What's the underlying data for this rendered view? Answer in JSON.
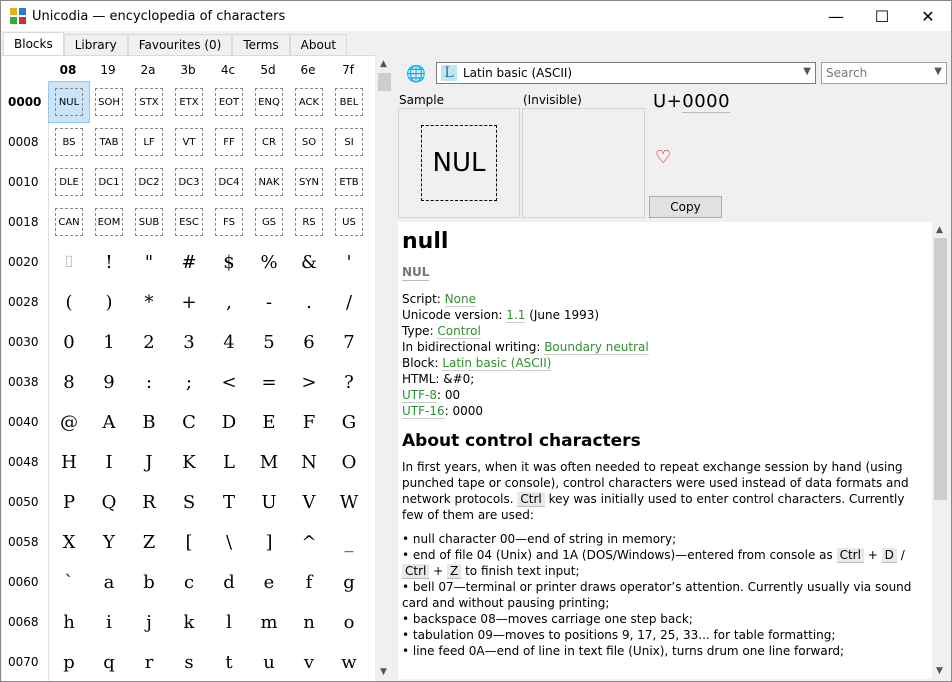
{
  "window": {
    "title": "Unicodia — encyclopedia of characters",
    "minimize": "—",
    "maximize": "☐",
    "close": "✕"
  },
  "tabs": [
    {
      "label": "Blocks",
      "active": true
    },
    {
      "label": "Library"
    },
    {
      "label": "Favourites (0)"
    },
    {
      "label": "Terms"
    },
    {
      "label": "About"
    }
  ],
  "table": {
    "columns": [
      "08",
      "19",
      "2a",
      "3b",
      "4c",
      "5d",
      "6e",
      "7f"
    ],
    "rows": [
      "0000",
      "0008",
      "0010",
      "0018",
      "0020",
      "0028",
      "0030",
      "0038",
      "0040",
      "0048",
      "0050",
      "0058",
      "0060",
      "0068",
      "0070"
    ],
    "cells": [
      [
        "NUL",
        "SOH",
        "STX",
        "ETX",
        "EOT",
        "ENQ",
        "ACK",
        "BEL"
      ],
      [
        "BS",
        "TAB",
        "LF",
        "VT",
        "FF",
        "CR",
        "SO",
        "SI"
      ],
      [
        "DLE",
        "DC1",
        "DC2",
        "DC3",
        "DC4",
        "NAK",
        "SYN",
        "ETB"
      ],
      [
        "CAN",
        "EOM",
        "SUB",
        "ESC",
        "FS",
        "GS",
        "RS",
        "US"
      ],
      [
        "⌷",
        "!",
        "\"",
        "#",
        "$",
        "%",
        "&",
        "'"
      ],
      [
        "(",
        ")",
        "*",
        "+",
        ",",
        "-",
        ".",
        "/"
      ],
      [
        "0",
        "1",
        "2",
        "3",
        "4",
        "5",
        "6",
        "7"
      ],
      [
        "8",
        "9",
        ":",
        ";",
        "<",
        "=",
        ">",
        "?"
      ],
      [
        "@",
        "A",
        "B",
        "C",
        "D",
        "E",
        "F",
        "G"
      ],
      [
        "H",
        "I",
        "J",
        "K",
        "L",
        "M",
        "N",
        "O"
      ],
      [
        "P",
        "Q",
        "R",
        "S",
        "T",
        "U",
        "V",
        "W"
      ],
      [
        "X",
        "Y",
        "Z",
        "[",
        "\\",
        "]",
        "^",
        "_"
      ],
      [
        "`",
        "a",
        "b",
        "c",
        "d",
        "e",
        "f",
        "g"
      ],
      [
        "h",
        "i",
        "j",
        "k",
        "l",
        "m",
        "n",
        "o"
      ],
      [
        "p",
        "q",
        "r",
        "s",
        "t",
        "u",
        "v",
        "w"
      ]
    ],
    "selected": "NUL"
  },
  "toolbar": {
    "block_icon_letter": "L",
    "block_name": "Latin basic (ASCII)",
    "search_placeholder": "Search"
  },
  "sample": {
    "label": "Sample",
    "invisible_label": "(Invisible)",
    "glyph": "NUL",
    "codepoint_prefix": "U+",
    "codepoint": "0000",
    "favourite_icon": "♡",
    "copy_label": "Copy"
  },
  "info": {
    "name": "null",
    "abbr": "NUL",
    "script_label": "Script: ",
    "script": "None",
    "version_label": "Unicode version: ",
    "version": "1.1",
    "version_date": " (June 1993)",
    "type_label": "Type: ",
    "type": "Control",
    "bidi_label": "In bidirectional writing: ",
    "bidi": "Boundary neutral",
    "block_label": "Block: ",
    "block": "Latin basic (ASCII)",
    "html_label": "HTML: ",
    "html": "&#0;",
    "utf8_label": "UTF-8",
    "utf8": ": 00",
    "utf16_label": "UTF-16",
    "utf16": ": 0000",
    "section_title": "About control characters",
    "para1a": "In first years, when it was often needed to repeat exchange session by hand (using punched tape or console), control characters were used instead of data formats and network protocols. ",
    "ctrl_key": "Ctrl",
    "para1b": " key was initially used to enter control characters. Currently few of them are used:",
    "b1": "• null character 00—end of string in memory;",
    "b2a": "• end of file 04 (Unix) and 1A (DOS/Windows)—entered from console as ",
    "k_ctrl1": "Ctrl",
    "k_plus1": " + ",
    "k_d": "D",
    "k_slash": " / ",
    "k_ctrl2": "Ctrl",
    "k_plus2": " + ",
    "k_z": "Z",
    "b2b": " to finish text input;",
    "b3": "• bell 07—terminal or printer draws operator’s attention. Currently usually via sound card and without pausing printing;",
    "b4": "• backspace 08—moves carriage one step back;",
    "b5": "• tabulation 09—moves to positions 9, 17, 25, 33... for table formatting;",
    "b6": "• line feed 0A—end of line in text file (Unix), turns drum one line forward;"
  }
}
